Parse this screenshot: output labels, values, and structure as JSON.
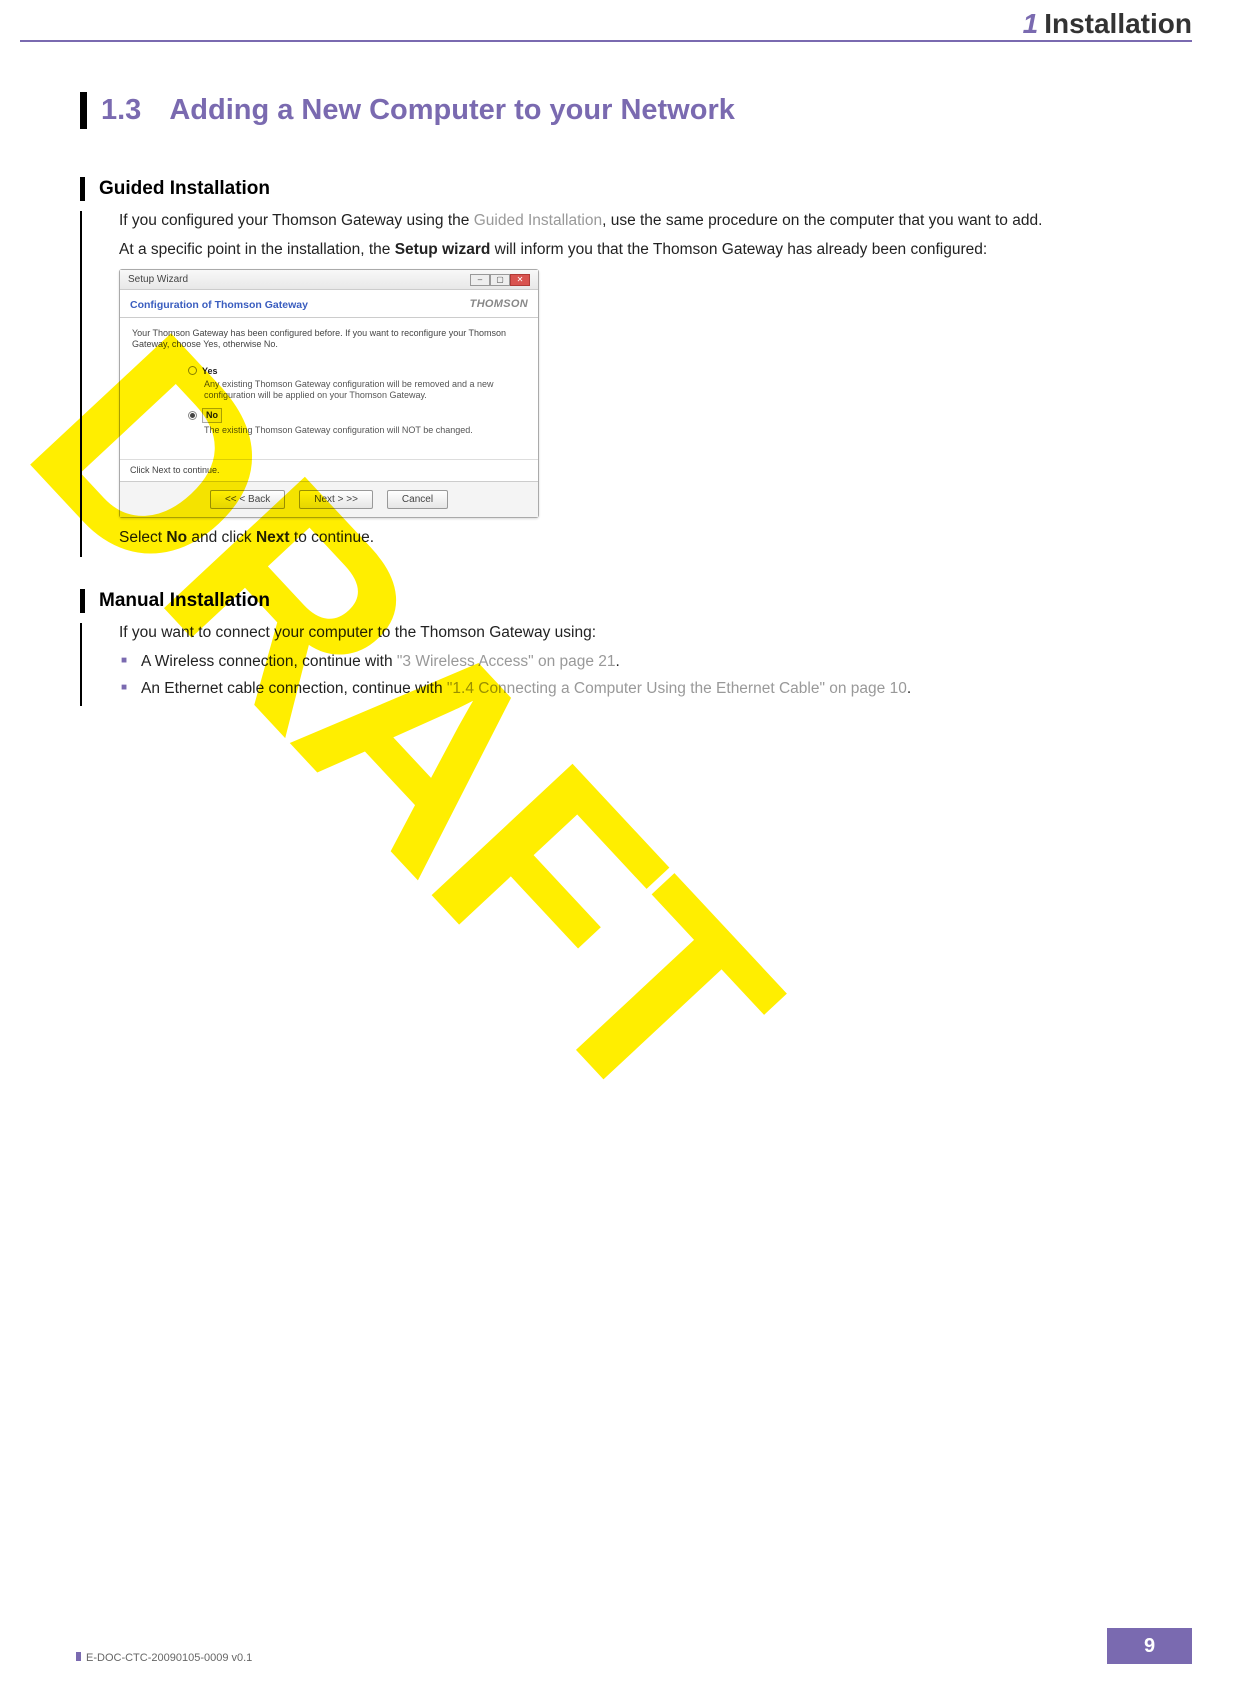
{
  "header": {
    "chapter_num": "1",
    "chapter_title": "Installation"
  },
  "section": {
    "number": "1.3",
    "title": "Adding a New Computer to your Network"
  },
  "guided": {
    "heading": "Guided Installation",
    "para1_a": "If you configured your Thomson Gateway using the ",
    "para1_link": "Guided Installation",
    "para1_b": ", use the same procedure on the computer that you want to add.",
    "para2_a": "At a specific point in the installation, the ",
    "para2_bold": "Setup wizard",
    "para2_b": " will inform you that the Thomson Gateway has already been configured:",
    "after_img_a": "Select ",
    "after_img_b": "No",
    "after_img_c": " and click ",
    "after_img_d": "Next",
    "after_img_e": " to continue."
  },
  "wizard": {
    "window_title": "Setup Wizard",
    "header_text": "Configuration of Thomson Gateway",
    "brand": "THOMSON",
    "intro": "Your Thomson Gateway has been configured before. If you want to reconfigure your Thomson Gateway, choose Yes, otherwise No.",
    "opt_yes": "Yes",
    "opt_yes_desc": "Any existing Thomson Gateway configuration will be removed and a new configuration will be applied on your Thomson Gateway.",
    "opt_no": "No",
    "opt_no_desc": "The existing Thomson Gateway configuration will NOT be changed.",
    "hint": "Click Next to continue.",
    "btn_back": "<<   < Back",
    "btn_next": "Next >   >>",
    "btn_cancel": "Cancel"
  },
  "manual": {
    "heading": "Manual Installation",
    "intro": "If you want to connect your computer to the Thomson Gateway using:",
    "b1_a": "A Wireless connection, continue with ",
    "b1_link": "\"3 Wireless Access\" on page 21",
    "b1_b": ".",
    "b2_a": "An Ethernet cable connection, continue with ",
    "b2_link": "\"1.4 Connecting a Computer Using the Ethernet Cable\" on page 10",
    "b2_b": "."
  },
  "watermark": "DRAFT",
  "footer": {
    "doc_id": "E-DOC-CTC-20090105-0009 v0.1",
    "page": "9"
  }
}
